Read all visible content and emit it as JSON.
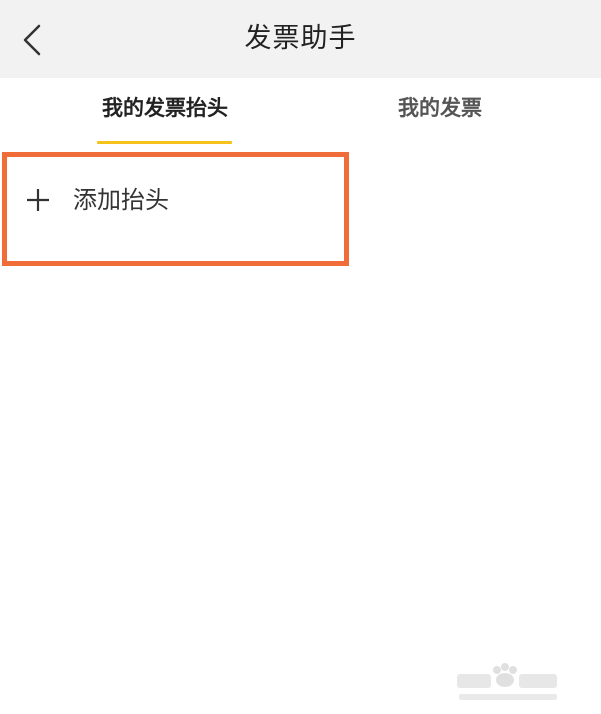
{
  "header": {
    "title": "发票助手"
  },
  "tabs": [
    {
      "label": "我的发票抬头",
      "active": true
    },
    {
      "label": "我的发票",
      "active": false
    }
  ],
  "add_header": {
    "label": "添加抬头"
  },
  "colors": {
    "header_bg": "#f2f2f2",
    "tab_indicator": "#f5c21b",
    "highlight_border": "#f06d3a"
  },
  "icons": {
    "back": "chevron-left-icon",
    "add": "plus-icon",
    "watermark": "baidu-jingyan-watermark"
  }
}
